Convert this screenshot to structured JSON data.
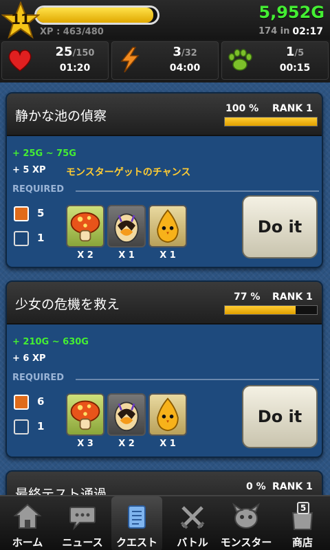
{
  "header": {
    "level": "11",
    "xp_text": "XP : 463/480",
    "xp_fraction": 0.965,
    "gold": "5,952G",
    "gold_timer_label": "174 in",
    "gold_timer": "02:17"
  },
  "stats": [
    {
      "name": "health",
      "value": "25",
      "max": "/150",
      "time": "01:20",
      "icon": "heart-icon",
      "color": "#e02020"
    },
    {
      "name": "energy",
      "value": "3",
      "max": "/32",
      "time": "04:00",
      "icon": "lightning-icon",
      "color": "#f08a20"
    },
    {
      "name": "stamina",
      "value": "1",
      "max": "/5",
      "time": "00:15",
      "icon": "paw-icon",
      "color": "#7cc02a"
    }
  ],
  "quests": [
    {
      "title": "静かな池の偵察",
      "percent": "100 %",
      "percent_value": 1.0,
      "rank": "RANK 1",
      "reward_gold": "+ 25G ~ 75G",
      "reward_xp": "+ 5 XP",
      "reward_extra": "モンスターゲットのチャンス",
      "required_label": "REQUIRED",
      "energy_req": "5",
      "member_req": "1",
      "monsters": [
        {
          "qty": "X 2"
        },
        {
          "qty": "X 1"
        },
        {
          "qty": "X 1"
        }
      ],
      "button": "Do it"
    },
    {
      "title": "少女の危機を救え",
      "percent": "77 %",
      "percent_value": 0.77,
      "rank": "RANK 1",
      "reward_gold": "+ 210G ~ 630G",
      "reward_xp": "+ 6 XP",
      "reward_extra": "",
      "required_label": "REQUIRED",
      "energy_req": "6",
      "member_req": "1",
      "monsters": [
        {
          "qty": "X 3"
        },
        {
          "qty": "X 2"
        },
        {
          "qty": "X 1"
        }
      ],
      "button": "Do it"
    },
    {
      "title": "最終テスト通過",
      "percent": "0 %",
      "percent_value": 0.0,
      "rank": "RANK 1"
    }
  ],
  "nav": [
    {
      "label": "ホーム",
      "icon": "home-icon",
      "active": false
    },
    {
      "label": "ニュース",
      "icon": "chat-bubble-icon",
      "active": false
    },
    {
      "label": "クエスト",
      "icon": "scroll-icon",
      "active": true
    },
    {
      "label": "バトル",
      "icon": "crossed-swords-icon",
      "active": false
    },
    {
      "label": "モンスター",
      "icon": "monster-head-icon",
      "active": false
    },
    {
      "label": "商店",
      "icon": "shop-bag-icon",
      "active": false,
      "badge": "5"
    }
  ]
}
